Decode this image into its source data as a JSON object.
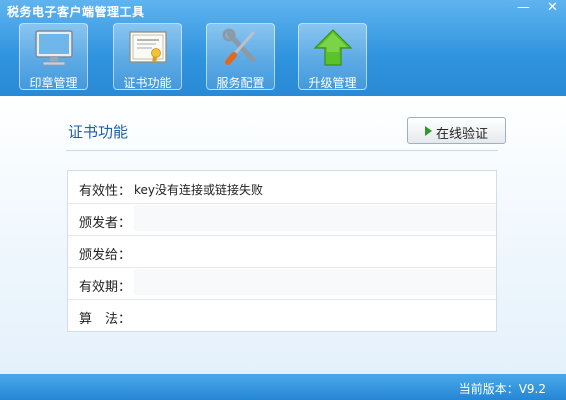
{
  "window": {
    "title": "税务电子客户端管理工具",
    "minimize": "—",
    "close": "✕"
  },
  "nav": [
    {
      "label": "印章管理",
      "icon": "monitor-icon"
    },
    {
      "label": "证书功能",
      "icon": "certificate-icon"
    },
    {
      "label": "服务配置",
      "icon": "tools-icon"
    },
    {
      "label": "升级管理",
      "icon": "upgrade-arrow-icon"
    }
  ],
  "main": {
    "section_title": "证书功能",
    "verify_button": "在线验证",
    "rows": [
      {
        "key": "有效性：",
        "value": "key没有连接或链接失败"
      },
      {
        "key": "颁发者：",
        "value": ""
      },
      {
        "key": "颁发给：",
        "value": ""
      },
      {
        "key": "有效期：",
        "value": ""
      },
      {
        "key": "算　法：",
        "value": ""
      }
    ]
  },
  "status": {
    "version": "当前版本：V9.2"
  },
  "colors": {
    "titlebar": "#2f93de",
    "accent_green": "#2e9a2e",
    "title_text": "#1f5fa8"
  }
}
